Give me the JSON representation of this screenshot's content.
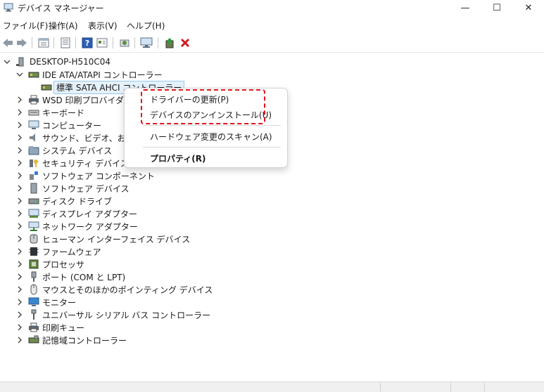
{
  "window": {
    "title": "デバイス マネージャー",
    "controls": {
      "minimize": "—",
      "maximize": "☐",
      "close": "✕"
    }
  },
  "menubar": [
    "ファイル(F)",
    "操作(A)",
    "表示(V)",
    "ヘルプ(H)"
  ],
  "toolbar": {
    "buttons": [
      "back-icon",
      "forward-icon",
      "show-hide-icon",
      "properties-icon",
      "help-icon",
      "view-icon",
      "scan-icon",
      "monitor-icon",
      "update-driver-icon",
      "uninstall-icon"
    ]
  },
  "tree": {
    "root": "DESKTOP-H510C04",
    "expanded_category": "IDE ATA/ATAPI コントローラー",
    "selected_device": "標準 SATA AHCI コントローラー",
    "categories": [
      "WSD 印刷プロバイダー",
      "キーボード",
      "コンピューター",
      "サウンド、ビデオ、およびゲ",
      "システム デバイス",
      "セキュリティ デバイス",
      "ソフトウェア コンポーネント",
      "ソフトウェア デバイス",
      "ディスク ドライブ",
      "ディスプレイ アダプター",
      "ネットワーク アダプター",
      "ヒューマン インターフェイス デバイス",
      "ファームウェア",
      "プロセッサ",
      "ポート (COM と LPT)",
      "マウスとそのほかのポインティング デバイス",
      "モニター",
      "ユニバーサル シリアル バス コントローラー",
      "印刷キュー",
      "記憶域コントローラー"
    ]
  },
  "context_menu": {
    "update_driver": "ドライバーの更新(P)",
    "uninstall_device": "デバイスのアンインストール(U)",
    "scan_hardware": "ハードウェア変更のスキャン(A)",
    "properties": "プロパティ(R)"
  },
  "colors": {
    "highlight": "#e0141e",
    "selection": "#e5f1fb",
    "accent": "#2b6cc4"
  }
}
